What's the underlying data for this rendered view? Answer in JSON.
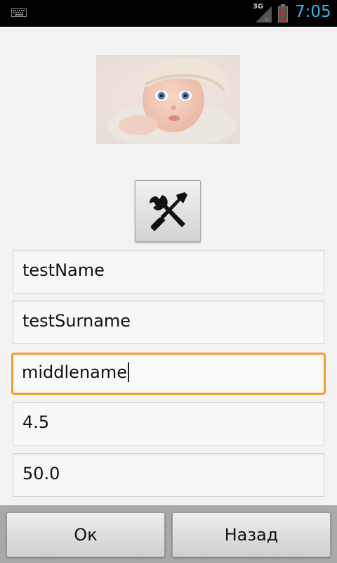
{
  "status_bar": {
    "network_label": "3G",
    "time": "7:05",
    "icons": [
      "keyboard-icon",
      "signal-icon",
      "battery-alert-icon"
    ],
    "clock_color": "#33b5e5"
  },
  "form": {
    "photo_icon": "baby-photo",
    "tools_button_icon": "wrench-screwdriver-icon",
    "fields": [
      {
        "value": "testName"
      },
      {
        "value": "testSurname"
      },
      {
        "value": "middlename",
        "focused": true
      },
      {
        "value": "4.5"
      },
      {
        "value": "50.0"
      }
    ],
    "focus_color": "#f0a030"
  },
  "buttons": {
    "ok_label": "Ок",
    "back_label": "Назад"
  }
}
